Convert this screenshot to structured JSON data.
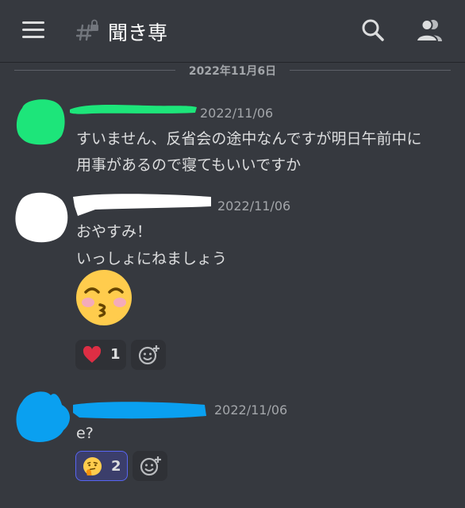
{
  "header": {
    "channel_name": "聞き専",
    "icons": {
      "menu": "hamburger-icon",
      "channel": "hashtag-lock-icon",
      "search": "search-icon",
      "members": "members-icon"
    }
  },
  "date_divider": "2022年11月6日",
  "messages": [
    {
      "timestamp": "2022/11/06",
      "avatar_color": "#1de57a",
      "lines": [
        "すいません、反省会の途中なんですが明日午前中に",
        "用事があるので寝てもいいですか"
      ]
    },
    {
      "timestamp": "2022/11/06",
      "avatar_color": "#ffffff",
      "lines": [
        "おやすみ！",
        "いっしょにねましょう"
      ],
      "emoji": "kissing-closed-eyes-emoji",
      "reactions": [
        {
          "emoji": "heart-icon",
          "count": "1"
        }
      ]
    },
    {
      "timestamp": "2022/11/06",
      "avatar_color": "#0aa0f0",
      "lines": [
        "e?"
      ],
      "reactions": [
        {
          "emoji": "thinking-face-emoji",
          "count": "2",
          "active": true
        }
      ]
    }
  ],
  "colors": {
    "background": "#36393f",
    "accent": "#5865f2",
    "scribble_green": "#1de57a",
    "scribble_blue": "#0aa0f0"
  }
}
